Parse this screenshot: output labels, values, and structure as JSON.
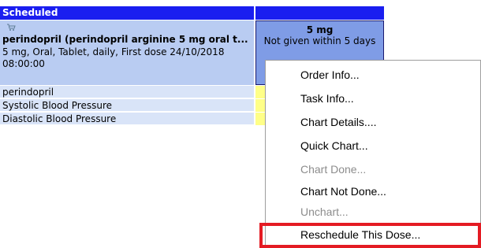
{
  "grid": {
    "header_label": "Scheduled",
    "order": {
      "icon": "medication-cart-icon",
      "title": "perindopril (perindopril arginine 5 mg oral t...",
      "detail": "5 mg, Oral, Tablet, daily, First dose 24/10/2018 08:00:00",
      "dose": "5 mg",
      "dose_status": "Not given within 5 days"
    },
    "sub_rows": [
      "perindopril",
      "Systolic Blood Pressure",
      "Diastolic Blood Pressure"
    ]
  },
  "context_menu": {
    "items": [
      {
        "label": "Order Info...",
        "enabled": true
      },
      {
        "label": "Task Info...",
        "enabled": true
      },
      {
        "label": "Chart Details....",
        "enabled": true
      },
      {
        "label": "Quick Chart...",
        "enabled": true
      },
      {
        "label": "Chart Done...",
        "enabled": false
      },
      {
        "label": "Chart Not Done...",
        "enabled": true
      },
      {
        "label": "Unchart...",
        "enabled": false
      },
      {
        "label": "Reschedule This Dose...",
        "enabled": true,
        "highlighted": true
      }
    ]
  },
  "colors": {
    "header_blue": "#1a1ef0",
    "order_bg": "#b9ccf2",
    "dose_cell_bg": "#7f9ce6",
    "sub_row_bg": "#d9e4f8",
    "pending_yellow": "#ffff88",
    "highlight_red": "#e41b23"
  }
}
